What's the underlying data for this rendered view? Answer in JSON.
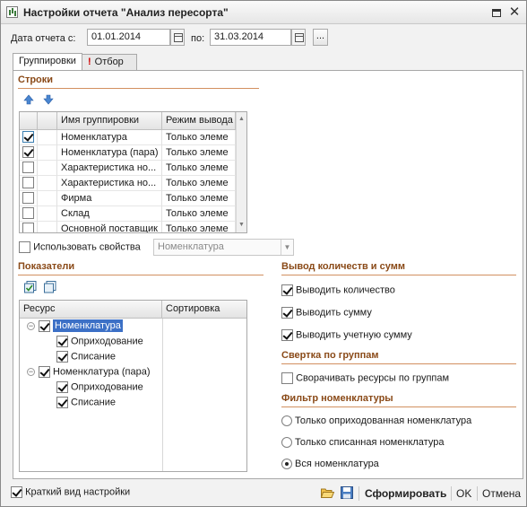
{
  "window": {
    "title": "Настройки отчета \"Анализ пересорта\"",
    "icons": {
      "app": "report-icon",
      "maximize": "maximize-icon",
      "close": "close-icon"
    }
  },
  "period": {
    "from_label": "Дата отчета с:",
    "from_value": "01.01.2014",
    "to_label": "по:",
    "to_value": "31.03.2014",
    "more_button": "..."
  },
  "tabs": [
    {
      "label": "Группировки",
      "active": true
    },
    {
      "label": "Отбор",
      "active": false,
      "warn": "!"
    }
  ],
  "rows_section": {
    "title": "Строки",
    "columns": [
      "Имя группировки",
      "Режим вывода"
    ],
    "rows": [
      {
        "checked": true,
        "name": "Номенклатура",
        "mode": "Только элеме"
      },
      {
        "checked": true,
        "name": "Номенклатура (пара)",
        "mode": "Только элеме"
      },
      {
        "checked": false,
        "name": "Характеристика но...",
        "mode": "Только элеме"
      },
      {
        "checked": false,
        "name": "Характеристика но...",
        "mode": "Только элеме"
      },
      {
        "checked": false,
        "name": "Фирма",
        "mode": "Только элеме"
      },
      {
        "checked": false,
        "name": "Склад",
        "mode": "Только элеме"
      },
      {
        "checked": false,
        "name": "Основной поставщик",
        "mode": "Только элеме"
      }
    ],
    "use_props_label": "Использовать свойства",
    "use_props_checked": false,
    "props_combo_value": "Номенклатура"
  },
  "indicators": {
    "title": "Показатели",
    "columns": [
      "Ресурс",
      "Сортировка"
    ],
    "tree": [
      {
        "label": "Номенклатура",
        "checked": true,
        "selected": true,
        "children": [
          {
            "label": "Оприходование",
            "checked": true
          },
          {
            "label": "Списание",
            "checked": true
          }
        ]
      },
      {
        "label": "Номенклатура (пара)",
        "checked": true,
        "selected": false,
        "children": [
          {
            "label": "Оприходование",
            "checked": true
          },
          {
            "label": "Списание",
            "checked": true
          }
        ]
      }
    ]
  },
  "output": {
    "title": "Вывод количеств и сумм",
    "options": [
      {
        "label": "Выводить количество",
        "checked": true
      },
      {
        "label": "Выводить сумму",
        "checked": true
      },
      {
        "label": "Выводить учетную сумму",
        "checked": true
      }
    ]
  },
  "collapse": {
    "title": "Свертка по группам",
    "option": {
      "label": "Сворачивать ресурсы по группам",
      "checked": false
    }
  },
  "nomenclature_filter": {
    "title": "Фильтр номенклатуры",
    "options": [
      {
        "label": "Только оприходованная номенклатура",
        "selected": false
      },
      {
        "label": "Только списанная номенклатура",
        "selected": false
      },
      {
        "label": "Вся номенклатура",
        "selected": true
      }
    ]
  },
  "footer": {
    "short_view_label": "Краткий вид настройки",
    "short_view_checked": true,
    "generate": "Сформировать",
    "ok": "OK",
    "cancel": "Отмена"
  }
}
